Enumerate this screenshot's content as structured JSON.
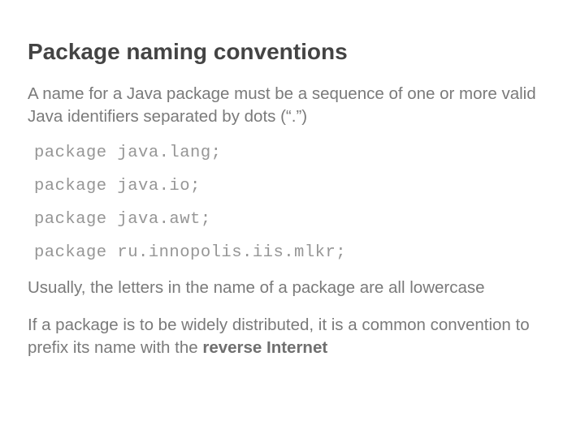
{
  "title": "Package naming conventions",
  "intro": "A name for a Java package must be a sequence of one or more valid Java identifiers separated by dots (“.”)",
  "code1": "package java.lang;",
  "code2": "package java.io;",
  "code3": "package java.awt;",
  "code4": "package ru.innopolis.iis.mlkr;",
  "para2": "Usually, the letters in the name of a package are all lowercase",
  "para3_a": "If a package is to be widely distributed, it is a common convention to prefix its name with the ",
  "para3_b": "reverse Internet"
}
